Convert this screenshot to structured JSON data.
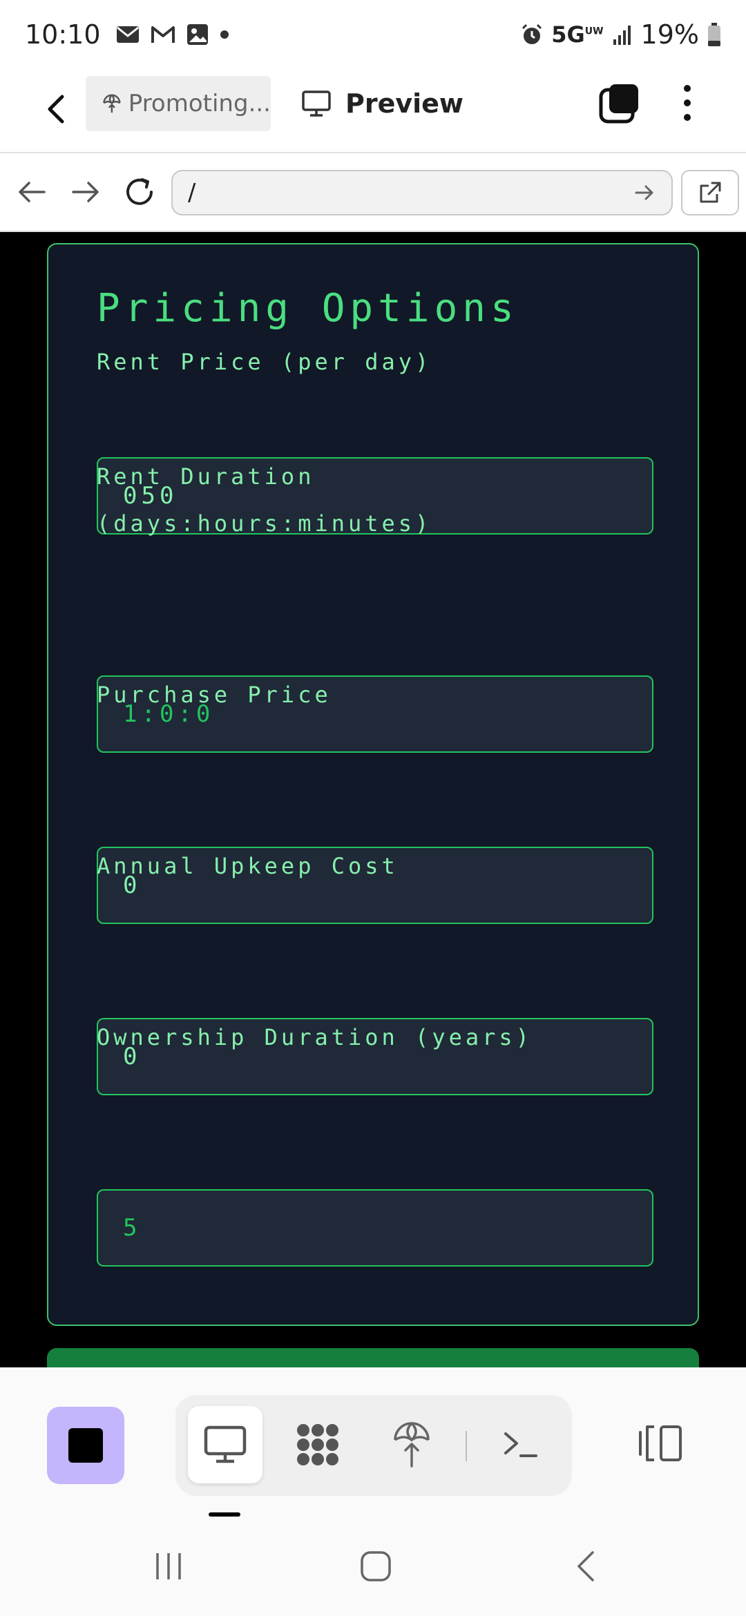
{
  "status_bar": {
    "time": "10:10",
    "network": "5G",
    "network_sup": "UW",
    "battery": "19%",
    "icons": [
      "email-icon",
      "gmail-icon",
      "gallery-icon",
      "dot-icon",
      "alarm-icon",
      "signal-icon",
      "battery-icon"
    ]
  },
  "header": {
    "tab_label": "Promoting...",
    "preview_label": "Preview"
  },
  "url_bar": {
    "url": "/"
  },
  "form": {
    "title": "Pricing Options",
    "fields": [
      {
        "label": "Rent Price (per day)",
        "value": "050"
      },
      {
        "label": "Rent Duration (days:hours:minutes)",
        "value": "1:0:0"
      },
      {
        "label": "Purchase Price",
        "value": "0"
      },
      {
        "label": "Annual Upkeep Cost",
        "value": "0"
      },
      {
        "label": "Ownership Duration (years)",
        "value": "5"
      }
    ]
  },
  "colors": {
    "card_bg": "#111827",
    "accent_green": "#4ade80",
    "label_green": "#86efac",
    "input_border": "#22c55e",
    "input_bg": "#1f2937",
    "stop_button": "#c4b5fd",
    "submit_button": "#15803d"
  },
  "toolbar": {
    "icons": [
      "stop-icon",
      "monitor-icon",
      "integrations-icon",
      "deploy-icon",
      "terminal-icon",
      "layout-toggle-icon"
    ]
  }
}
